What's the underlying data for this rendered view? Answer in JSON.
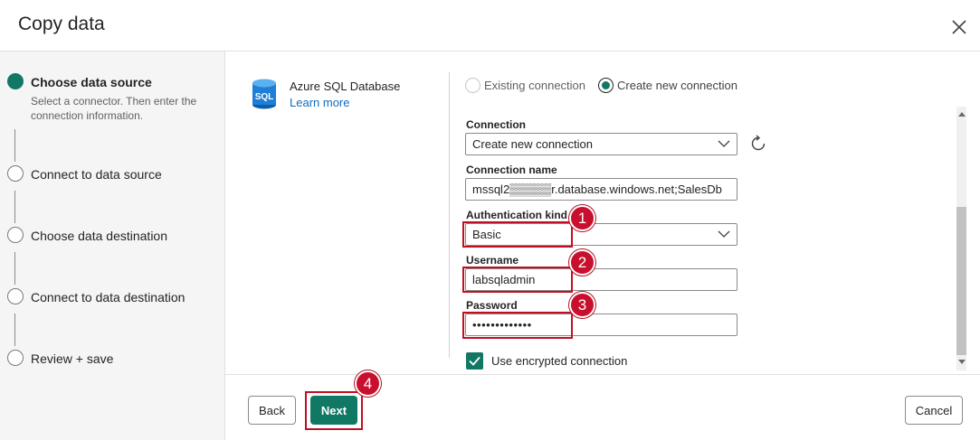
{
  "dialog": {
    "title": "Copy data",
    "close_icon": "close-icon"
  },
  "steps": [
    {
      "label": "Choose data source",
      "description": "Select a connector. Then enter the connection information.",
      "active": true
    },
    {
      "label": "Connect to data source",
      "active": false
    },
    {
      "label": "Choose data destination",
      "active": false
    },
    {
      "label": "Connect to data destination",
      "active": false
    },
    {
      "label": "Review + save",
      "active": false
    }
  ],
  "connector": {
    "icon": "azure-sql-database-icon",
    "icon_text": "SQL",
    "name": "Azure SQL Database",
    "link": "Learn more"
  },
  "connection_mode": {
    "options": [
      "Existing connection",
      "Create new connection"
    ],
    "selected": "Create new connection"
  },
  "form": {
    "connection": {
      "label": "Connection",
      "value": "Create new connection"
    },
    "connection_name": {
      "label": "Connection name",
      "value": "mssql2▒▒▒▒▒r.database.windows.net;SalesDb"
    },
    "auth_kind": {
      "label": "Authentication kind",
      "value": "Basic"
    },
    "username": {
      "label": "Username",
      "value": "labsqladmin"
    },
    "password": {
      "label": "Password",
      "value": "•••••••••••••"
    },
    "encrypted": {
      "label": "Use encrypted connection",
      "checked": true
    }
  },
  "footer": {
    "back": "Back",
    "next": "Next",
    "cancel": "Cancel"
  },
  "annotations": {
    "badges": [
      "1",
      "2",
      "3",
      "4"
    ]
  },
  "colors": {
    "accent": "#117865",
    "link": "#0f6cbd",
    "annotation": "#c8102e"
  }
}
